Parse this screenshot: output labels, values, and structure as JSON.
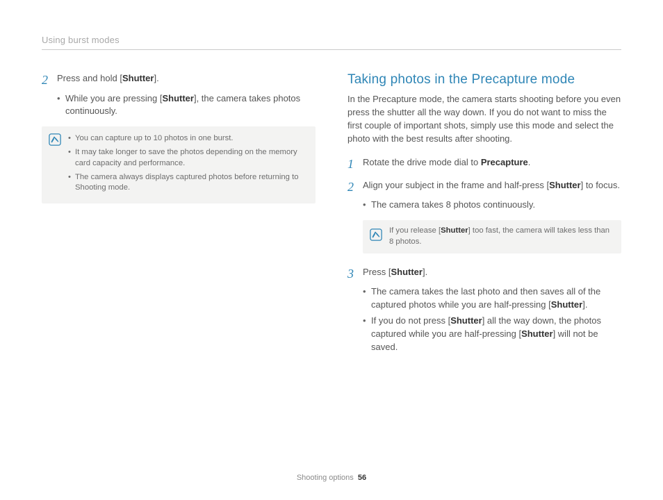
{
  "header": {
    "running_title": "Using burst modes"
  },
  "footer": {
    "section": "Shooting options",
    "page": "56"
  },
  "left": {
    "step2": {
      "num": "2",
      "prefix": "Press and hold [",
      "bold": "Shutter",
      "suffix": "]."
    },
    "sub1": {
      "a": "While you are pressing [",
      "b": "Shutter",
      "c": "], the camera takes photos continuously."
    },
    "note": {
      "li1": "You can capture up to 10 photos in one burst.",
      "li2": "It may take longer to save the photos depending on the memory card capacity and performance.",
      "li3": "The camera always displays captured photos before returning to Shooting mode."
    }
  },
  "right": {
    "title": "Taking photos in the Precapture mode",
    "lead": "In the Precapture mode, the camera starts shooting before you even press the shutter all the way down. If you do not want to miss the first couple of important shots, simply use this mode and select the photo with the best results after shooting.",
    "step1": {
      "num": "1",
      "prefix": "Rotate the drive mode dial to ",
      "bold": "Precapture",
      "suffix": "."
    },
    "step2": {
      "num": "2",
      "prefix": "Align your subject in the frame and half-press [",
      "bold": "Shutter",
      "suffix": "] to focus."
    },
    "step2_sub1": "The camera takes 8 photos continuously.",
    "note2": {
      "a": "If you release [",
      "b": "Shutter",
      "c": "] too fast, the camera will takes less than 8 photos."
    },
    "step3": {
      "num": "3",
      "prefix": "Press [",
      "bold": "Shutter",
      "suffix": "]."
    },
    "step3_sub1": {
      "a": "The camera takes the last photo and then saves all of the captured photos while you are half-pressing [",
      "b": "Shutter",
      "c": "]."
    },
    "step3_sub2": {
      "a": "If you do not press [",
      "b": "Shutter",
      "c": "] all the way down, the photos captured while you are half-pressing [",
      "d": "Shutter",
      "e": "] will not be saved."
    }
  }
}
